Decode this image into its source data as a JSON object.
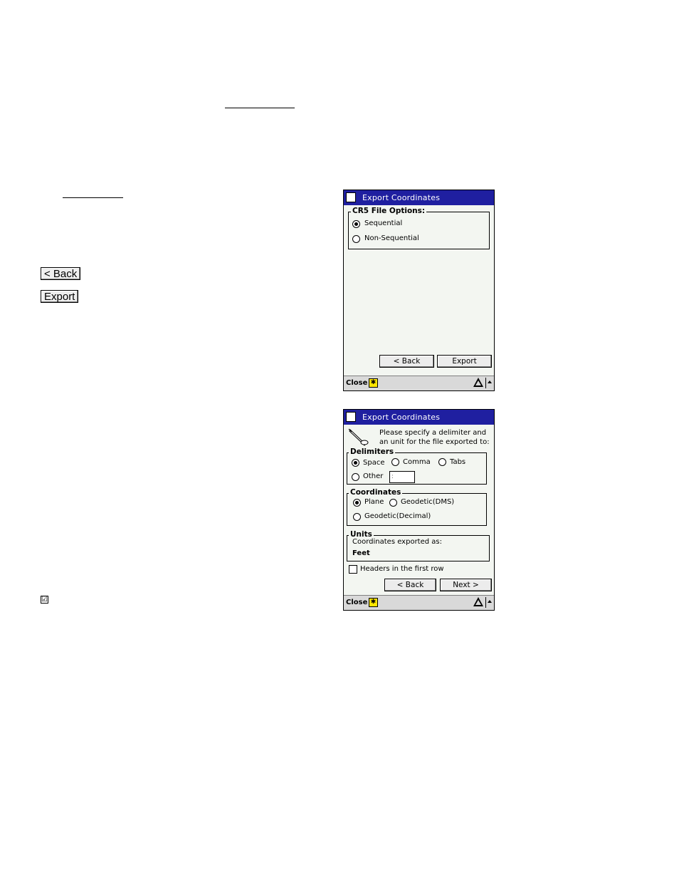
{
  "doc": {
    "back_button": "< Back",
    "export_button": "Export",
    "checkbox_glyph": "☑"
  },
  "screen1": {
    "title": "Export Coordinates",
    "group_title": "CR5 File Options:",
    "options": [
      "Sequential",
      "Non-Sequential"
    ],
    "back_label": "< Back",
    "export_label": "Export",
    "close_label": "Close"
  },
  "screen2": {
    "title": "Export Coordinates",
    "instruction": "Please specify a delimiter and an unit for the file exported to:",
    "delimiters_title": "Delimiters",
    "delimiters": [
      "Space",
      "Comma",
      "Tabs",
      "Other"
    ],
    "other_value": ":",
    "coordinates_title": "Coordinates",
    "coordinates": [
      "Plane",
      "Geodetic(DMS)",
      "Geodetic(Decimal)"
    ],
    "units_title": "Units",
    "units_caption": "Coordinates exported as:",
    "units_value": "Feet",
    "headers_label": "Headers in the first row",
    "back_label": "< Back",
    "next_label": "Next >",
    "close_label": "Close"
  }
}
